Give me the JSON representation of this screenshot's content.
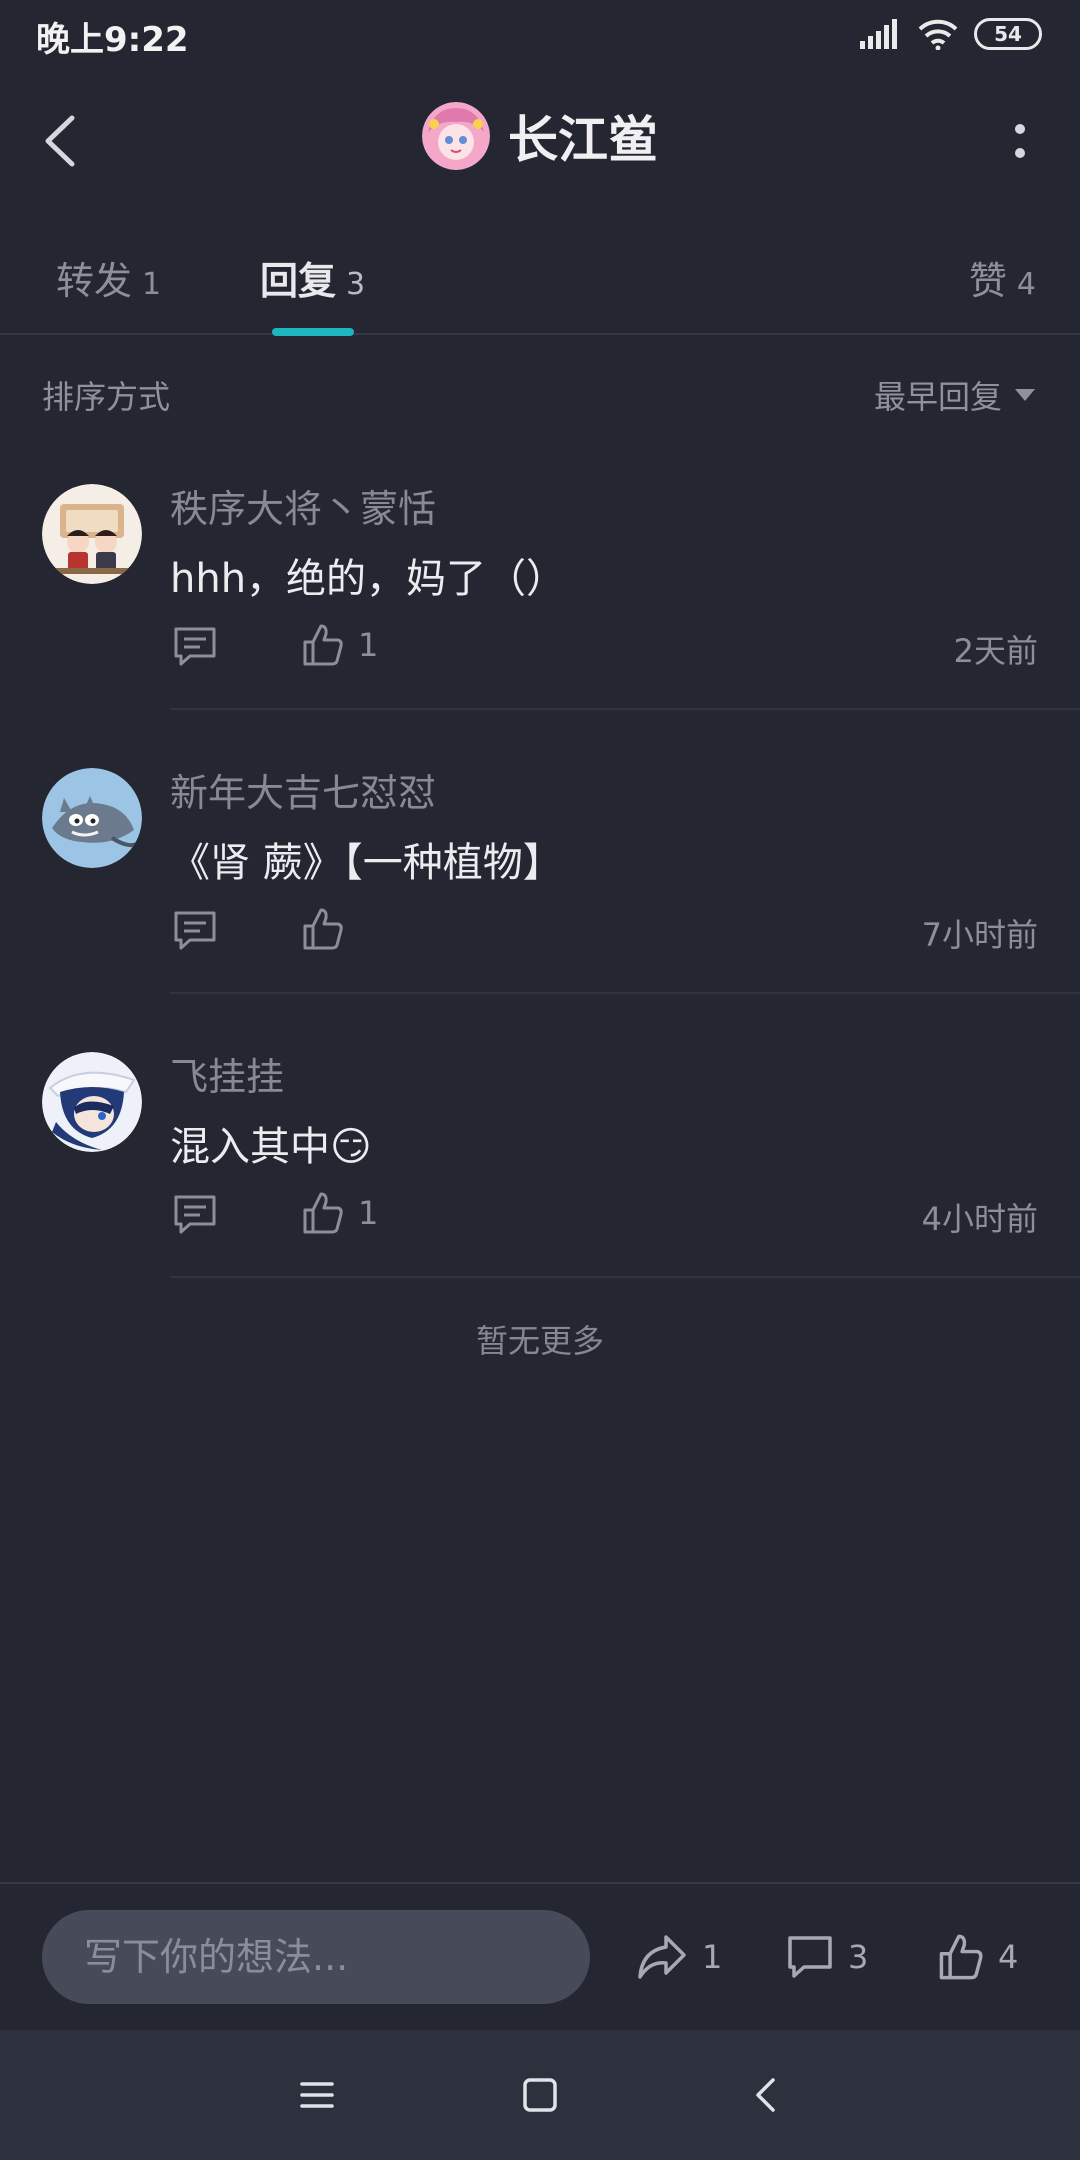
{
  "status_bar": {
    "time": "晚上9:22",
    "battery": "54"
  },
  "header": {
    "title": "长江鲎"
  },
  "tabs": [
    {
      "label": "转发",
      "count": "1"
    },
    {
      "label": "回复",
      "count": "3"
    },
    {
      "label": "赞",
      "count": "4"
    }
  ],
  "sort": {
    "label": "排序方式",
    "value": "最早回复"
  },
  "comments": [
    {
      "name": "秩序大将丶蒙恬",
      "text": "hhh，绝的，妈了（）",
      "likes": "1",
      "time": "2天前"
    },
    {
      "name": "新年大吉七怼怼",
      "text": "《肾 蕨》【一种植物】",
      "likes": "",
      "time": "7小时前"
    },
    {
      "name": "飞挂挂",
      "text": "混入其中😏",
      "likes": "1",
      "time": "4小时前"
    }
  ],
  "no_more": "暂无更多",
  "bottom_bar": {
    "input_placeholder": "写下你的想法...",
    "repost_count": "1",
    "comment_count": "3",
    "like_count": "4"
  },
  "colors": {
    "accent": "#1fb5bf",
    "background": "#242631"
  }
}
